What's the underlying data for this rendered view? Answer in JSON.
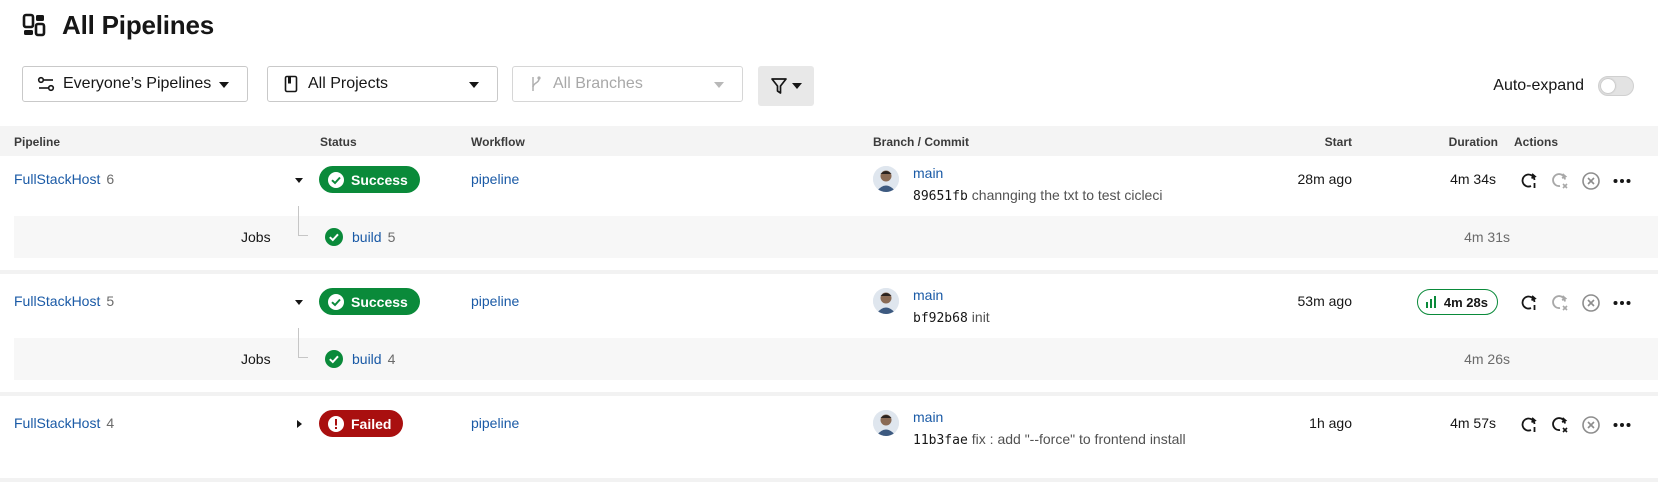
{
  "page": {
    "title": "All Pipelines"
  },
  "filters": {
    "pipelines_scope": "Everyone’s Pipelines",
    "projects": "All Projects",
    "branches": "All Branches",
    "auto_expand_label": "Auto-expand",
    "auto_expand_on": false
  },
  "table": {
    "headers": {
      "pipeline": "Pipeline",
      "status": "Status",
      "workflow": "Workflow",
      "branch_commit": "Branch / Commit",
      "start": "Start",
      "duration": "Duration",
      "actions": "Actions"
    },
    "jobs_label": "Jobs",
    "rows": [
      {
        "project": "FullStackHost",
        "number": "6",
        "status": "Success",
        "workflow": "pipeline",
        "branch": "main",
        "sha": "89651fb",
        "message": "channging the txt to test cicleci",
        "start": "28m ago",
        "duration": "4m 34s",
        "job": {
          "name": "build",
          "number": "5",
          "duration": "4m 31s"
        }
      },
      {
        "project": "FullStackHost",
        "number": "5",
        "status": "Success",
        "workflow": "pipeline",
        "branch": "main",
        "sha": "bf92b68",
        "message": "init",
        "start": "53m ago",
        "duration": "4m 28s",
        "job": {
          "name": "build",
          "number": "4",
          "duration": "4m 26s"
        }
      },
      {
        "project": "FullStackHost",
        "number": "4",
        "status": "Failed",
        "workflow": "pipeline",
        "branch": "main",
        "sha": "11b3fae",
        "message": "fix : add \"--force\" to frontend install",
        "start": "1h ago",
        "duration": "4m 57s"
      }
    ]
  },
  "colors": {
    "success": "#0a8a3a",
    "failed": "#a90f0f",
    "link": "#1a5aa6"
  }
}
